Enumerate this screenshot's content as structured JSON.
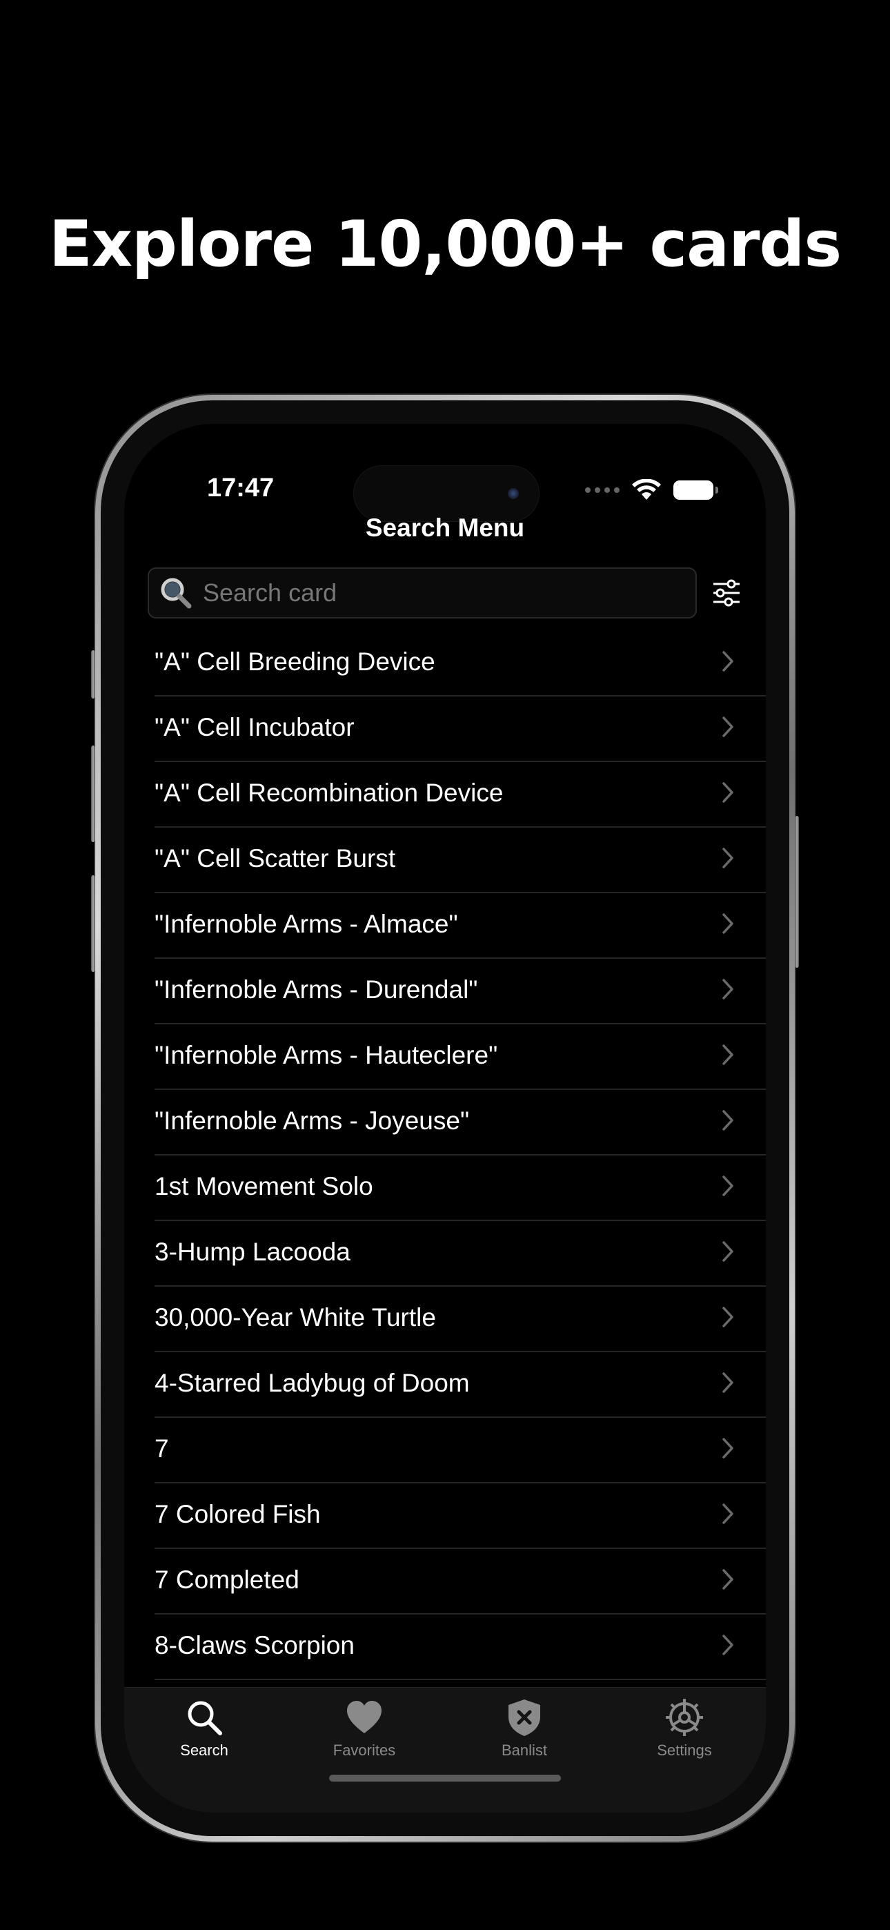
{
  "headline": "Explore 10,000+ cards",
  "status_bar": {
    "time": "17:47"
  },
  "nav": {
    "title": "Search Menu"
  },
  "search": {
    "value": "",
    "placeholder": "Search card"
  },
  "cards": [
    {
      "name": "\"A\" Cell Breeding Device"
    },
    {
      "name": "\"A\" Cell Incubator"
    },
    {
      "name": "\"A\" Cell Recombination Device"
    },
    {
      "name": "\"A\" Cell Scatter Burst"
    },
    {
      "name": "\"Infernoble Arms - Almace\""
    },
    {
      "name": "\"Infernoble Arms - Durendal\""
    },
    {
      "name": "\"Infernoble Arms - Hauteclere\""
    },
    {
      "name": "\"Infernoble Arms - Joyeuse\""
    },
    {
      "name": "1st Movement Solo"
    },
    {
      "name": "3-Hump Lacooda"
    },
    {
      "name": "30,000-Year White Turtle"
    },
    {
      "name": "4-Starred Ladybug of Doom"
    },
    {
      "name": "7"
    },
    {
      "name": "7 Colored Fish"
    },
    {
      "name": "7 Completed"
    },
    {
      "name": "8-Claws Scorpion"
    }
  ],
  "tab_bar": {
    "tabs": [
      {
        "label": "Search",
        "icon": "search-icon",
        "active": true
      },
      {
        "label": "Favorites",
        "icon": "heart-icon",
        "active": false
      },
      {
        "label": "Banlist",
        "icon": "shield-x-icon",
        "active": false
      },
      {
        "label": "Settings",
        "icon": "gear-icon",
        "active": false
      }
    ]
  },
  "colors": {
    "background": "#000000",
    "text": "#ffffff",
    "inactive_tab": "#8a8a8a",
    "separator": "#262626"
  }
}
